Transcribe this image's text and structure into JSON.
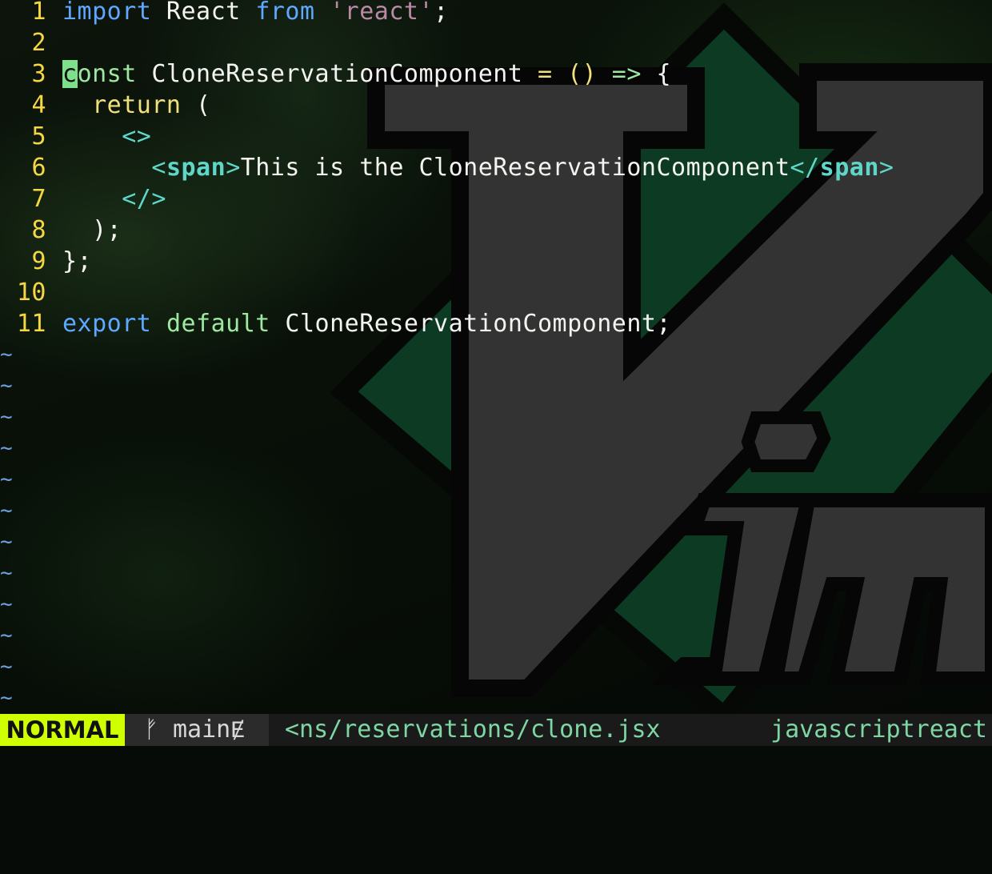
{
  "editor": {
    "lines": [
      {
        "n": "1",
        "parts": [
          {
            "t": "import",
            "c": "kw"
          },
          {
            "t": " React ",
            "c": "punc"
          },
          {
            "t": "from",
            "c": "kw"
          },
          {
            "t": " ",
            "c": "punc"
          },
          {
            "t": "'react'",
            "c": "str"
          },
          {
            "t": ";",
            "c": "punc"
          }
        ]
      },
      {
        "n": "2",
        "parts": []
      },
      {
        "n": "3",
        "parts": [
          {
            "t": "c",
            "c": "cursor"
          },
          {
            "t": "onst",
            "c": "kw2"
          },
          {
            "t": " CloneReservationComponent ",
            "c": "punc"
          },
          {
            "t": "=",
            "c": "kw3"
          },
          {
            "t": " ",
            "c": "punc"
          },
          {
            "t": "()",
            "c": "kw3"
          },
          {
            "t": " ",
            "c": "punc"
          },
          {
            "t": "=>",
            "c": "op"
          },
          {
            "t": " {",
            "c": "punc"
          }
        ]
      },
      {
        "n": "4",
        "parts": [
          {
            "t": "  ",
            "c": "punc"
          },
          {
            "t": "return",
            "c": "kw3"
          },
          {
            "t": " (",
            "c": "punc"
          }
        ]
      },
      {
        "n": "5",
        "parts": [
          {
            "t": "    ",
            "c": "punc"
          },
          {
            "t": "<>",
            "c": "tag"
          }
        ]
      },
      {
        "n": "6",
        "parts": [
          {
            "t": "      ",
            "c": "punc"
          },
          {
            "t": "<",
            "c": "tag"
          },
          {
            "t": "span",
            "c": "tagname"
          },
          {
            "t": ">",
            "c": "tag"
          },
          {
            "t": "This is the CloneReservationComponent",
            "c": "punc"
          },
          {
            "t": "</",
            "c": "tag"
          },
          {
            "t": "span",
            "c": "tagname"
          },
          {
            "t": ">",
            "c": "tag"
          }
        ]
      },
      {
        "n": "7",
        "parts": [
          {
            "t": "    ",
            "c": "punc"
          },
          {
            "t": "</>",
            "c": "tag"
          }
        ]
      },
      {
        "n": "8",
        "parts": [
          {
            "t": "  );",
            "c": "punc"
          }
        ]
      },
      {
        "n": "9",
        "parts": [
          {
            "t": "};",
            "c": "punc"
          }
        ]
      },
      {
        "n": "10",
        "parts": []
      },
      {
        "n": "11",
        "parts": [
          {
            "t": "export",
            "c": "kw"
          },
          {
            "t": " ",
            "c": "punc"
          },
          {
            "t": "default",
            "c": "kw2"
          },
          {
            "t": " CloneReservationComponent;",
            "c": "punc"
          }
        ]
      }
    ],
    "empty_line_marker": "~",
    "empty_line_count": 12
  },
  "statusline": {
    "mode": "NORMAL",
    "branch_icon": "ᚠ",
    "branch": "main",
    "branch_modified_icon": "Ɇ",
    "filename": "<ns/reservations/clone.jsx",
    "filetype": "javascriptreact"
  },
  "colors": {
    "line_number": "#f5d742",
    "mode_bg": "#cfff00",
    "cursor": "#7ee08a",
    "tag": "#5fd7c8",
    "keyword": "#5fa8ff"
  },
  "background": {
    "logo": "vim-logo"
  }
}
